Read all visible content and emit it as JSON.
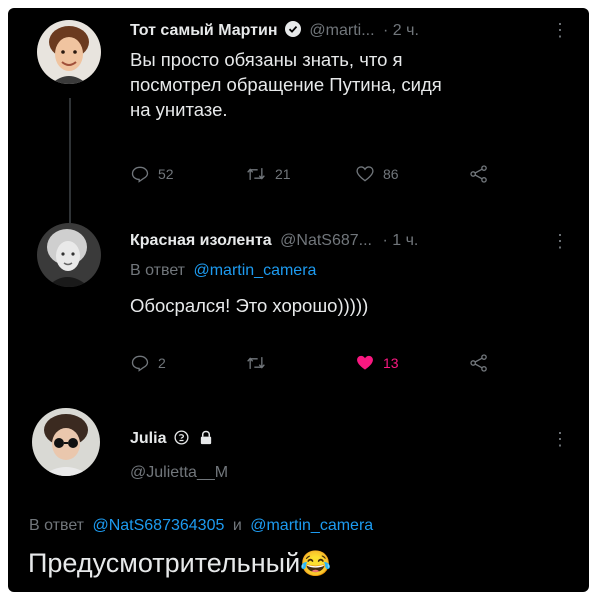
{
  "tweets": [
    {
      "name": "Тот самый Мартин",
      "verified": true,
      "handle": "@marti...",
      "time": "· 2 ч.",
      "text_lines": [
        "Вы просто обязаны знать, что я",
        "посмотрел обращение Путина, сидя",
        "на унитазе."
      ],
      "actions": {
        "replies": "52",
        "retweets": "21",
        "likes": "86"
      }
    },
    {
      "name": "Красная изолента",
      "handle": "@NatS687...",
      "time": "· 1 ч.",
      "reply_prefix": "В ответ",
      "reply_to": "@martin_camera",
      "text": "Обосрался! Это хорошо)))))",
      "actions": {
        "replies": "2",
        "retweets": "",
        "likes": "13",
        "liked": true
      }
    },
    {
      "name": "Julia",
      "handle": "@Julietta__M",
      "reply_prefix": "В ответ",
      "reply_to_1": "@NatS687364305",
      "reply_joiner": "и",
      "reply_to_2": "@martin_camera",
      "text": "Предусмотрительный",
      "emoji": "😂"
    }
  ],
  "colors": {
    "background": "#000000",
    "text": "#e7e9ea",
    "muted": "#71767b",
    "link": "#1d9bf0",
    "like": "#f91880"
  },
  "icons": [
    "more-icon",
    "verified-icon",
    "reply-icon",
    "retweet-icon",
    "like-icon",
    "share-icon",
    "lock-icon"
  ]
}
